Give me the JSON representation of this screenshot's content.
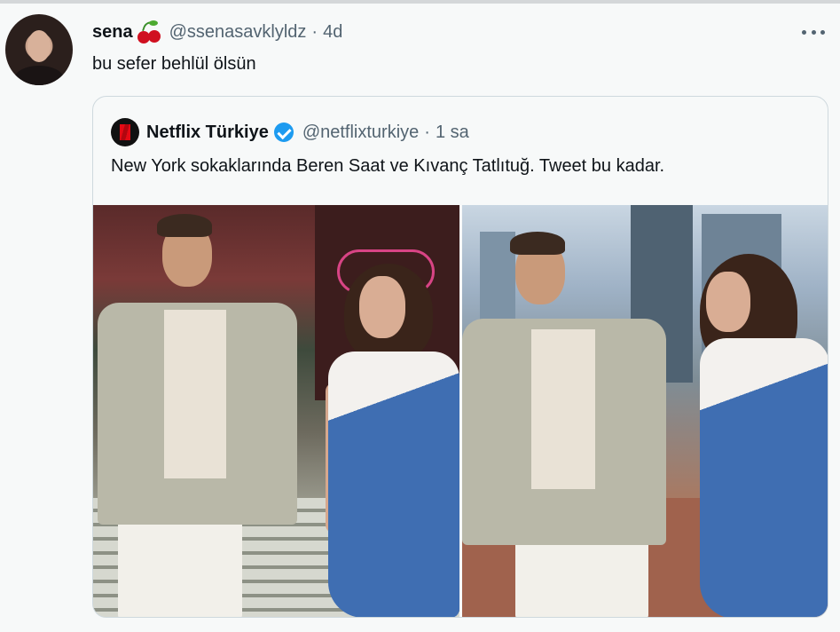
{
  "tweet": {
    "display_name": "sena",
    "handle": "@ssenasavklyldz",
    "separator": "·",
    "time": "4d",
    "text": "bu sefer behlül ölsün"
  },
  "quoted": {
    "display_name": "Netflix Türkiye",
    "handle": "@netflixturkiye",
    "separator": "·",
    "time": "1 sa",
    "text": "New York sokaklarında Beren Saat ve Kıvanç Tatlıtuğ. Tweet bu kadar."
  },
  "icons": {
    "name_emoji": "cherry-icon",
    "more": "more-icon",
    "verified": "verified-icon",
    "brand_logo": "netflix-logo-icon"
  },
  "colors": {
    "background": "#f7f9f9",
    "secondary_text": "#536471",
    "verified": "#1d9bf0",
    "border": "#cfd9de"
  }
}
